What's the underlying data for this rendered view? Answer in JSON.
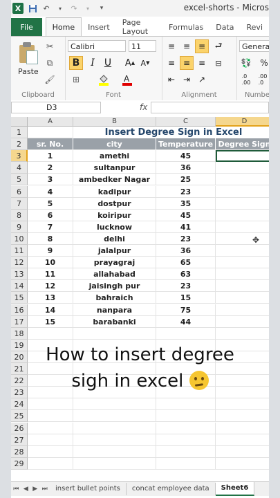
{
  "window": {
    "title": "excel-shorts - Micros"
  },
  "ribbon": {
    "file_tab": "File",
    "tabs": [
      "Home",
      "Insert",
      "Page Layout",
      "Formulas",
      "Data",
      "Revi"
    ],
    "active_tab": "Home",
    "paste_label": "Paste",
    "font_name": "Calibri",
    "font_size": "11",
    "number_format": "General",
    "groups": [
      "Clipboard",
      "Font",
      "Alignment",
      "Numbe"
    ]
  },
  "formula_bar": {
    "name_box": "D3",
    "fx": "fx",
    "content": ""
  },
  "sheet": {
    "columns": [
      "A",
      "B",
      "C",
      "D"
    ],
    "rows": [
      "1",
      "2",
      "3",
      "4",
      "5",
      "6",
      "7",
      "8",
      "9",
      "10",
      "11",
      "12",
      "13",
      "14",
      "15",
      "16",
      "17",
      "18",
      "19",
      "20",
      "21",
      "22",
      "23",
      "24",
      "25",
      "26",
      "27",
      "28",
      "29"
    ],
    "title": "Insert Degree Sign in Excel",
    "headers": [
      "sr. No.",
      "city",
      "Temperature",
      "Degree Sign"
    ],
    "table": [
      [
        "1",
        "amethi",
        "45"
      ],
      [
        "2",
        "sultanpur",
        "36"
      ],
      [
        "3",
        "ambedker Nagar",
        "25"
      ],
      [
        "4",
        "kadipur",
        "23"
      ],
      [
        "5",
        "dostpur",
        "35"
      ],
      [
        "6",
        "koiripur",
        "45"
      ],
      [
        "7",
        "lucknow",
        "41"
      ],
      [
        "8",
        "delhi",
        "23"
      ],
      [
        "9",
        "jalalpur",
        "36"
      ],
      [
        "10",
        "prayagraj",
        "65"
      ],
      [
        "11",
        "allahabad",
        "63"
      ],
      [
        "12",
        "jaisingh pur",
        "23"
      ],
      [
        "13",
        "bahraich",
        "15"
      ],
      [
        "14",
        "nanpara",
        "75"
      ],
      [
        "15",
        "barabanki",
        "44"
      ]
    ],
    "active_cell": "D3"
  },
  "caption": {
    "line1": "How to insert degree",
    "line2": "sigh in excel",
    "emoji": "thinking-face"
  },
  "sheet_tabs": {
    "tabs": [
      "insert bullet points",
      "concat employee data",
      "Sheet6"
    ],
    "active": "Sheet6"
  }
}
